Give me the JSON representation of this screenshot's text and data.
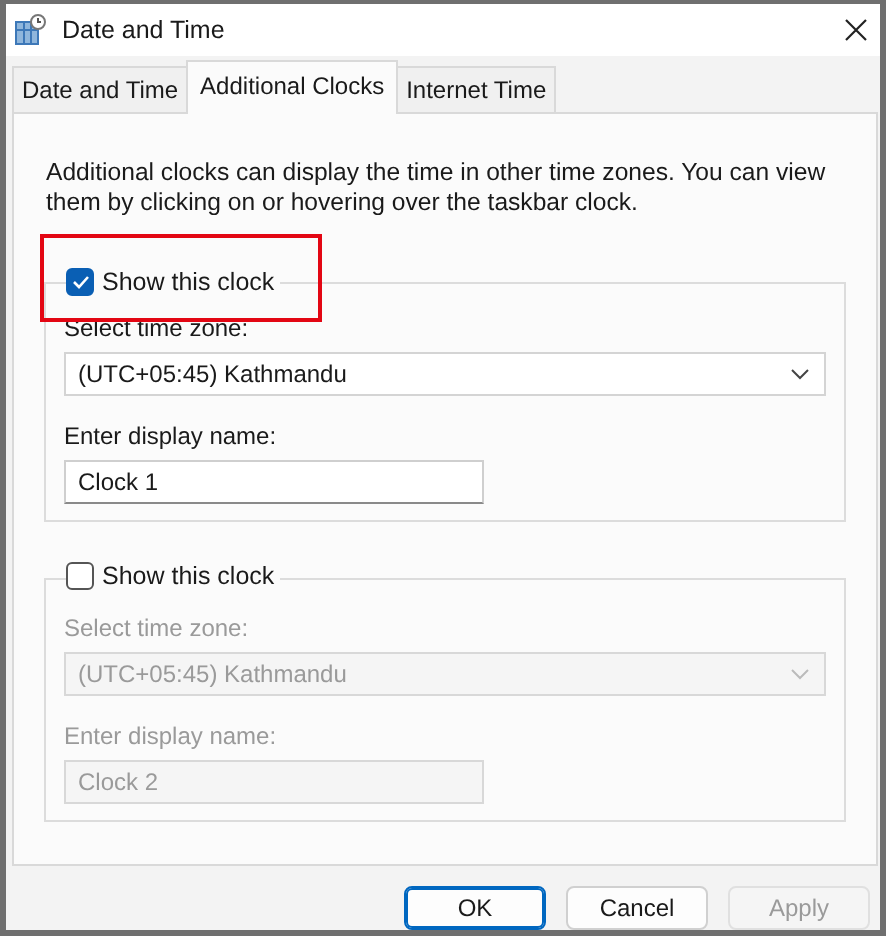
{
  "window": {
    "title": "Date and Time"
  },
  "tabs": [
    {
      "label": "Date and Time",
      "selected": false
    },
    {
      "label": "Additional Clocks",
      "selected": true
    },
    {
      "label": "Internet Time",
      "selected": false
    }
  ],
  "description": "Additional clocks can display the time in other time zones. You can view them by clicking on or hovering over the taskbar clock.",
  "clocks": [
    {
      "show": true,
      "highlighted": true,
      "show_label": "Show this clock",
      "timezone_label": "Select time zone:",
      "timezone": "(UTC+05:45) Kathmandu",
      "name_label": "Enter display name:",
      "display_name": "Clock 1"
    },
    {
      "show": false,
      "highlighted": false,
      "show_label": "Show this clock",
      "timezone_label": "Select time zone:",
      "timezone": "(UTC+05:45) Kathmandu",
      "name_label": "Enter display name:",
      "display_name": "Clock 2"
    }
  ],
  "buttons": [
    {
      "label": "OK",
      "default": true,
      "disabled": false
    },
    {
      "label": "Cancel",
      "default": false,
      "disabled": false
    },
    {
      "label": "Apply",
      "default": false,
      "disabled": true
    }
  ]
}
